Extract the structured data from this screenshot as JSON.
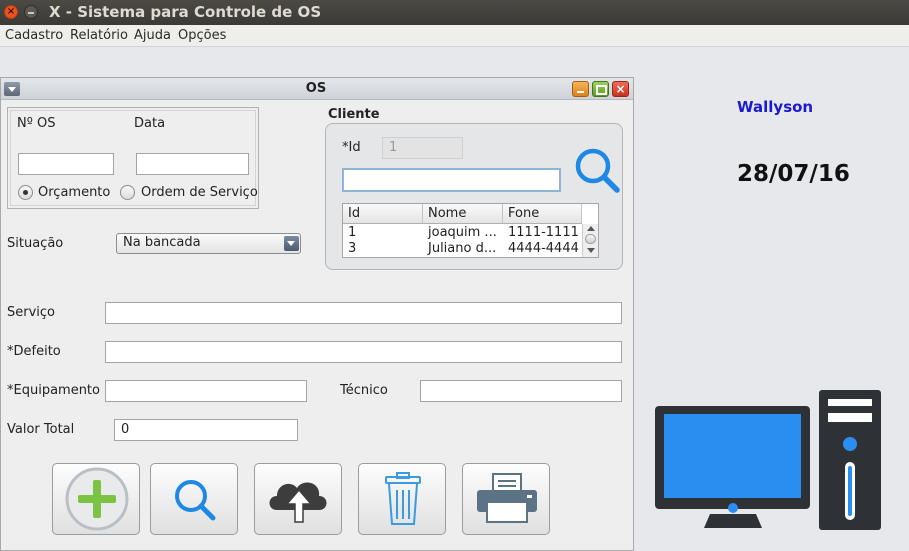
{
  "window": {
    "title": "X - Sistema para Controle de OS"
  },
  "menu": [
    "Cadastro",
    "Relatório",
    "Ajuda",
    "Opções"
  ],
  "internal_frame": {
    "title": "OS"
  },
  "os_group": {
    "numero_label": "Nº OS",
    "data_label": "Data",
    "numero_value": "",
    "data_value": "",
    "radio_orcamento": "Orçamento",
    "radio_ordem": "Ordem de Serviço",
    "selected": "Orçamento"
  },
  "situacao": {
    "label": "Situação",
    "value": "Na bancada"
  },
  "cliente": {
    "title": "Cliente",
    "id_label": "*Id",
    "id_value": "1",
    "search_value": "",
    "table": {
      "headers": [
        "Id",
        "Nome",
        "Fone"
      ],
      "rows": [
        [
          "1",
          "joaquim ...",
          "1111-1111"
        ],
        [
          "3",
          "Juliano d...",
          "4444-4444"
        ]
      ]
    }
  },
  "form": {
    "servico_label": "Serviço",
    "defeito_label": "*Defeito",
    "equipamento_label": "*Equipamento",
    "tecnico_label": "Técnico",
    "valor_label": "Valor Total",
    "servico_value": "",
    "defeito_value": "",
    "equipamento_value": "",
    "tecnico_value": "",
    "valor_value": "0"
  },
  "icons": {
    "add": "plus-icon",
    "search": "search-icon",
    "update": "cloud-upload-icon",
    "delete": "trash-icon",
    "print": "printer-icon",
    "computer": "computer-icon"
  },
  "colors": {
    "user": "#1a1ad2",
    "accent_blue": "#1e88e5",
    "add_green": "#7cc243"
  },
  "user": "Wallyson",
  "date": "28/07/16"
}
